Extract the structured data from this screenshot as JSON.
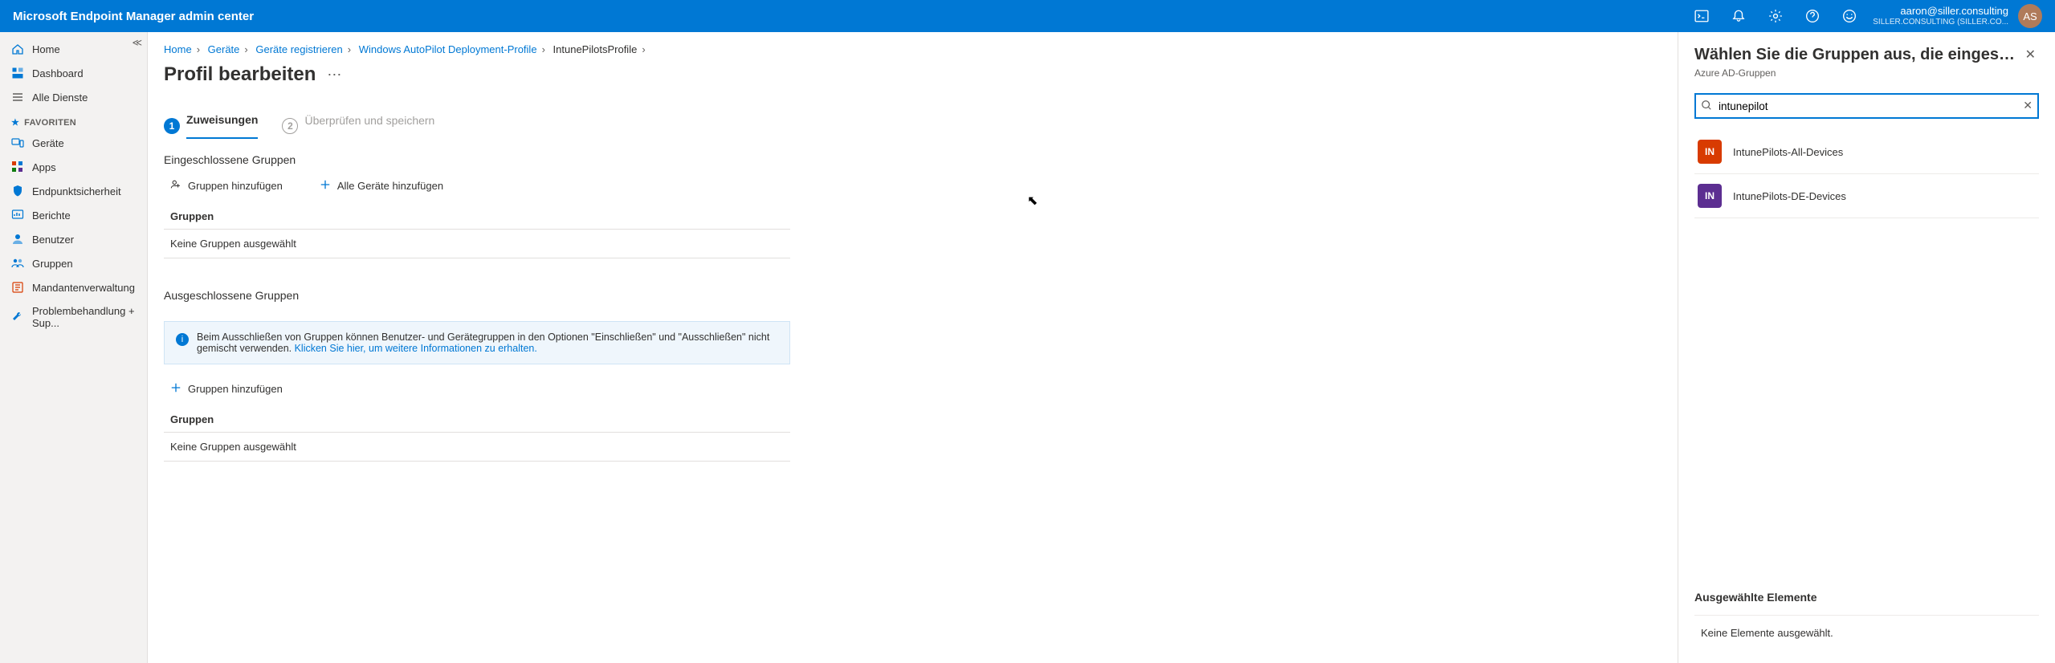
{
  "topbar": {
    "title": "Microsoft Endpoint Manager admin center",
    "user_email": "aaron@siller.consulting",
    "user_org": "SILLER.CONSULTING (SILLER.CO...",
    "avatar_initials": "AS"
  },
  "sidebar": {
    "items": [
      {
        "label": "Home",
        "icon": "home",
        "color": "#0078d4"
      },
      {
        "label": "Dashboard",
        "icon": "dashboard",
        "color": "#0078d4"
      },
      {
        "label": "Alle Dienste",
        "icon": "list",
        "color": "#605e5c"
      }
    ],
    "fav_heading": "FAVORITEN",
    "favs": [
      {
        "label": "Geräte",
        "icon": "devices",
        "color": "#0078d4"
      },
      {
        "label": "Apps",
        "icon": "apps",
        "color": "#d83b01"
      },
      {
        "label": "Endpunktsicherheit",
        "icon": "shield",
        "color": "#0078d4"
      },
      {
        "label": "Berichte",
        "icon": "reports",
        "color": "#0078d4"
      },
      {
        "label": "Benutzer",
        "icon": "user",
        "color": "#0078d4"
      },
      {
        "label": "Gruppen",
        "icon": "group",
        "color": "#0078d4"
      },
      {
        "label": "Mandantenverwaltung",
        "icon": "tenant",
        "color": "#d83b01"
      },
      {
        "label": "Problembehandlung + Sup...",
        "icon": "wrench",
        "color": "#0078d4"
      }
    ]
  },
  "crumbs": [
    "Home",
    "Geräte",
    "Geräte registrieren",
    "Windows AutoPilot Deployment-Profile",
    "IntunePilotsProfile"
  ],
  "page_title": "Profil bearbeiten",
  "wizard": {
    "step1": "Zuweisungen",
    "step2": "Überprüfen und speichern"
  },
  "included": {
    "heading": "Eingeschlossene Gruppen",
    "add_groups": "Gruppen hinzufügen",
    "add_all": "Alle Geräte hinzufügen",
    "col": "Gruppen",
    "empty": "Keine Gruppen ausgewählt"
  },
  "excluded": {
    "heading": "Ausgeschlossene Gruppen",
    "info_text": "Beim Ausschließen von Gruppen können Benutzer- und Gerätegruppen in den Optionen \"Einschließen\" und \"Ausschließen\" nicht gemischt verwenden. ",
    "info_link": "Klicken Sie hier, um weitere Informationen zu erhalten.",
    "add_groups": "Gruppen hinzufügen",
    "col": "Gruppen",
    "empty": "Keine Gruppen ausgewählt"
  },
  "panel": {
    "title": "Wählen Sie die Gruppen aus, die eingeschlo...",
    "subtitle": "Azure AD-Gruppen",
    "search_value": "intunepilot",
    "results": [
      {
        "badge": "IN",
        "label": "IntunePilots-All-Devices"
      },
      {
        "badge": "IN",
        "label": "IntunePilots-DE-Devices"
      }
    ],
    "selected_heading": "Ausgewählte Elemente",
    "selected_empty": "Keine Elemente ausgewählt."
  }
}
